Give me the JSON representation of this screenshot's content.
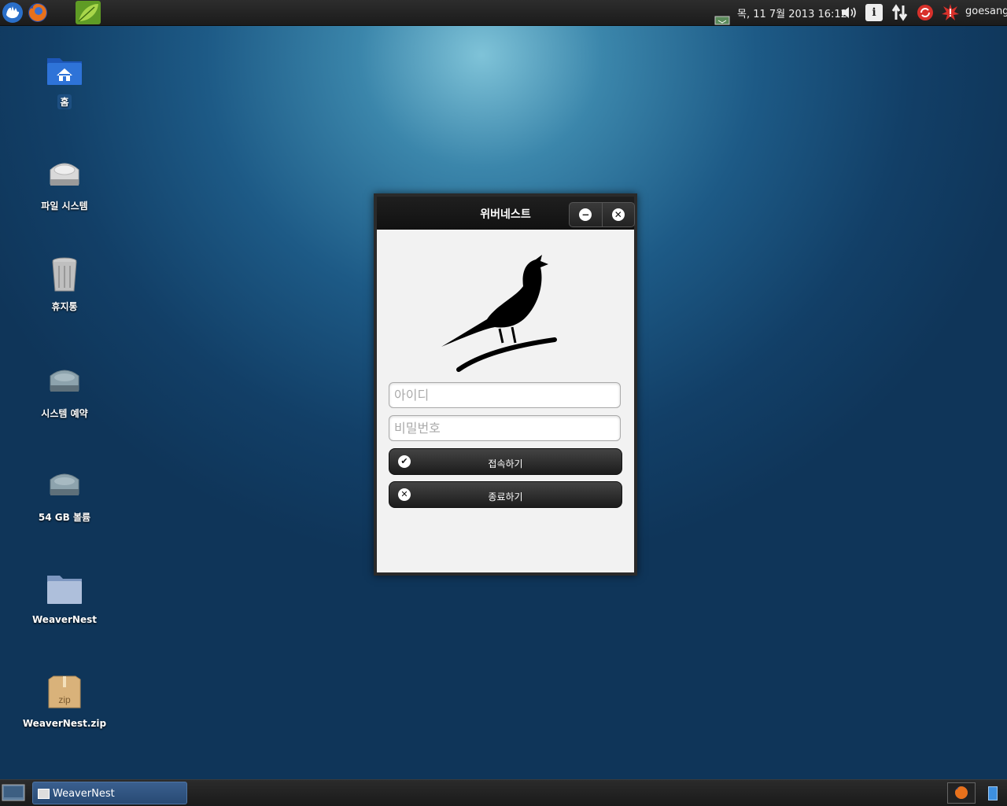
{
  "top_panel": {
    "launchers": [
      "xfce-menu-icon",
      "firefox-icon",
      "leaf-app-icon"
    ],
    "clock": "목, 11  7월 2013 16:12",
    "user": "goesang",
    "tray_icons": [
      "network-icon",
      "volume-icon",
      "info-icon",
      "transfer-icon",
      "update-icon",
      "alert-icon"
    ]
  },
  "desktop": {
    "icons": [
      {
        "label": "홈",
        "icon": "home-folder-icon"
      },
      {
        "label": "파일 시스템",
        "icon": "filesystem-drive-icon"
      },
      {
        "label": "휴지통",
        "icon": "trash-icon"
      },
      {
        "label": "시스템 예약",
        "icon": "drive-icon"
      },
      {
        "label": "54 GB 볼륨",
        "icon": "drive-icon"
      },
      {
        "label": "WeaverNest",
        "icon": "folder-icon"
      },
      {
        "label": "WeaverNest.zip",
        "icon": "zip-archive-icon"
      }
    ]
  },
  "dialog": {
    "title": "위버네스트",
    "minimize_icon": "minus-icon",
    "close_icon": "close-icon",
    "logo": "bird-logo-icon",
    "id_placeholder": "아이디",
    "password_placeholder": "비밀번호",
    "connect_label": "접속하기",
    "exit_label": "종료하기"
  },
  "taskbar": {
    "window_label": "WeaverNest"
  }
}
